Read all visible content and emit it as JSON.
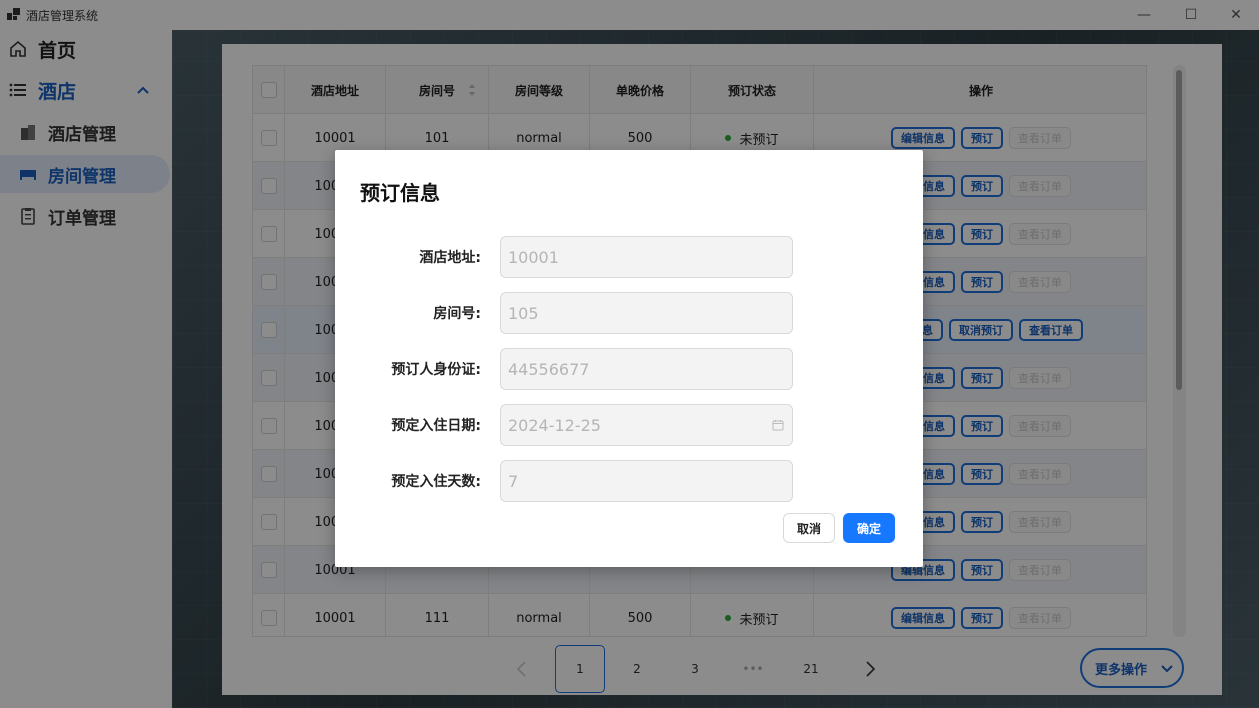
{
  "window": {
    "title": "酒店管理系统",
    "minimize_glyph": "—",
    "maximize_glyph": "☐",
    "close_glyph": "✕"
  },
  "sidebar": {
    "home": {
      "label": "首页",
      "icon": "home-icon"
    },
    "group": {
      "label": "酒店",
      "icon": "list-icon",
      "expanded": true
    },
    "items": [
      {
        "label": "酒店管理",
        "icon": "building-icon",
        "active": false
      },
      {
        "label": "房间管理",
        "icon": "bed-icon",
        "active": true
      },
      {
        "label": "订单管理",
        "icon": "clipboard-icon",
        "active": false
      }
    ]
  },
  "table": {
    "headers": [
      "酒店地址",
      "房间号",
      "房间等级",
      "单晚价格",
      "预订状态",
      "操作"
    ],
    "rows": [
      {
        "address": "10001",
        "room": "101",
        "level": "normal",
        "price": "500",
        "status": "未预订"
      },
      {
        "address": "10001",
        "room": "",
        "level": "",
        "price": "",
        "status": ""
      },
      {
        "address": "10001",
        "room": "",
        "level": "",
        "price": "",
        "status": ""
      },
      {
        "address": "10001",
        "room": "",
        "level": "",
        "price": "",
        "status": ""
      },
      {
        "address": "10001",
        "room": "",
        "level": "",
        "price": "",
        "status": "",
        "booked": true
      },
      {
        "address": "10001",
        "room": "",
        "level": "",
        "price": "",
        "status": ""
      },
      {
        "address": "10001",
        "room": "",
        "level": "",
        "price": "",
        "status": ""
      },
      {
        "address": "10001",
        "room": "",
        "level": "",
        "price": "",
        "status": ""
      },
      {
        "address": "10001",
        "room": "",
        "level": "",
        "price": "",
        "status": ""
      },
      {
        "address": "10001",
        "room": "",
        "level": "",
        "price": "",
        "status": ""
      },
      {
        "address": "10001",
        "room": "111",
        "level": "normal",
        "price": "500",
        "status": "未预订"
      }
    ],
    "actions": {
      "edit": "编辑信息",
      "book": "预订",
      "view": "查看订单",
      "cancel_booking": "取消预订"
    },
    "status_color": "#2eaa3c"
  },
  "pagination": {
    "pages": [
      "1",
      "2",
      "3",
      "•••",
      "21"
    ],
    "current": "1",
    "more_label": "更多操作"
  },
  "modal": {
    "title": "预订信息",
    "fields": [
      {
        "label": "酒店地址:",
        "value": "10001"
      },
      {
        "label": "房间号:",
        "value": "105"
      },
      {
        "label": "预订人身份证:",
        "value": "44556677"
      },
      {
        "label": "预定入住日期:",
        "value": "2024-12-25"
      },
      {
        "label": "预定入住天数:",
        "value": "7"
      }
    ],
    "cancel_label": "取消",
    "ok_label": "确定"
  },
  "colors": {
    "accent": "#1677ff",
    "brand_blue": "#1a5fc0",
    "sidebar_active_bg": "#e3ecf9"
  }
}
